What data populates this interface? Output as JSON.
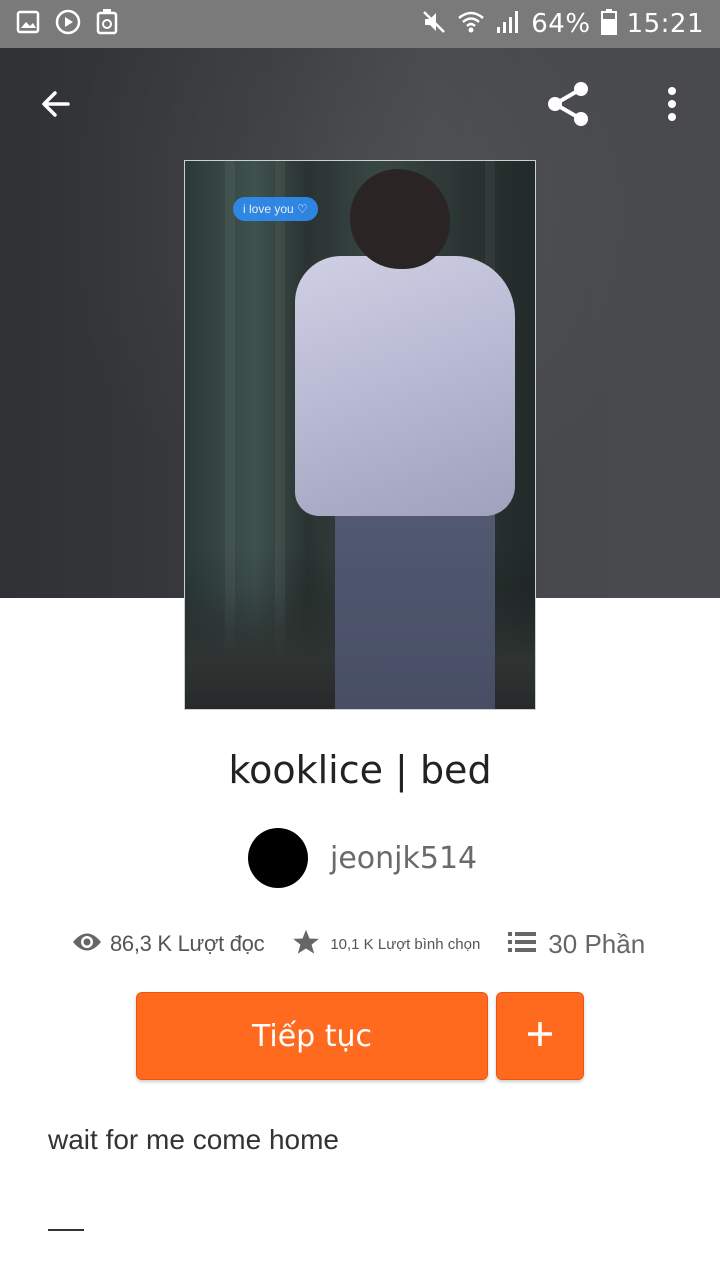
{
  "status_bar": {
    "battery": "64%",
    "time": "15:21"
  },
  "toolbar": {
    "back_icon": "arrow-left-icon",
    "share_icon": "share-icon",
    "more_icon": "more-vertical-icon"
  },
  "cover": {
    "bubble_text": "i love you ♡"
  },
  "story": {
    "title": "kooklice | bed",
    "author": "jeonjk514",
    "description": "wait for me come home"
  },
  "stats": {
    "reads": "86,3 K Lượt đọc",
    "votes": "10,1 K Lượt bình chọn",
    "parts": "30 Phần"
  },
  "actions": {
    "continue_label": "Tiếp tục",
    "add_icon": "plus-icon"
  },
  "colors": {
    "accent": "#ff6a1f",
    "status_bar": "#7a7a7a",
    "header_bg": "#3a3c40"
  }
}
